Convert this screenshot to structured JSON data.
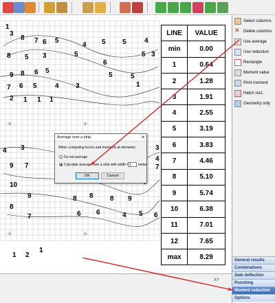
{
  "toolbar": {
    "icons": [
      "grid-icon",
      "node-icon",
      "box-icon",
      "pipe-icon",
      "funnel-icon",
      "axis-icon",
      "axis-plane-icon",
      "slab-icon",
      "wall-icon",
      "zoom-in-icon",
      "zoom-out-icon",
      "zoom-all-icon",
      "zoom-window-icon",
      "zoom-prev-icon",
      "layers-icon"
    ]
  },
  "table": {
    "headers": [
      "LINE",
      "VALUE"
    ],
    "rows": [
      {
        "line": "min",
        "value": "0.00"
      },
      {
        "line": "1",
        "value": "0.64"
      },
      {
        "line": "2",
        "value": "1.28"
      },
      {
        "line": "3",
        "value": "1.91"
      },
      {
        "line": "4",
        "value": "2.55"
      },
      {
        "line": "5",
        "value": "3.19"
      },
      {
        "line": "6",
        "value": "3.83"
      },
      {
        "line": "7",
        "value": "4.46"
      },
      {
        "line": "8",
        "value": "5.10"
      },
      {
        "line": "9",
        "value": "5.74"
      },
      {
        "line": "10",
        "value": "6.38"
      },
      {
        "line": "11",
        "value": "7.01"
      },
      {
        "line": "12",
        "value": "7.65"
      },
      {
        "line": "max",
        "value": "8.29"
      }
    ]
  },
  "panel": {
    "items": [
      {
        "label": "Select columns",
        "icon": "select-columns-icon"
      },
      {
        "label": "Delete columns",
        "icon": "delete-columns-icon"
      },
      {
        "label": "Use average",
        "icon": "use-average-icon"
      },
      {
        "label": "Use reduction",
        "icon": "use-reduction-icon"
      },
      {
        "label": "Rectangle",
        "icon": "rectangle-icon"
      },
      {
        "label": "Moment value",
        "icon": "moment-value-icon"
      },
      {
        "label": "Print moment",
        "icon": "print-moment-icon"
      },
      {
        "label": "Hatch rect.",
        "icon": "hatch-rect-icon"
      },
      {
        "label": "Geometry only",
        "icon": "geometry-only-icon"
      }
    ],
    "sections": [
      {
        "label": "General results",
        "active": false
      },
      {
        "label": "Combinations",
        "active": false
      },
      {
        "label": "Slab deflection",
        "active": false
      },
      {
        "label": "Punching",
        "active": false
      },
      {
        "label": "Moment reduction",
        "active": true
      },
      {
        "label": "Options",
        "active": false
      }
    ],
    "accent": "#3d6fb8"
  },
  "dialog": {
    "title": "Average over a strip",
    "description": "When computing forces and moments at elements:",
    "option_no_average": "Do not average",
    "option_calc_average": "Calculate average over a strip with width =",
    "width_value": "1",
    "unit": "meter",
    "ok_label": "OK",
    "cancel_label": "Cancel",
    "selected_option": "option_calc_average"
  },
  "canvas": {
    "contour_label_color": "#000000",
    "arrow_color": "#e02020",
    "side_labels": [
      "2",
      "2",
      "1"
    ],
    "bottom_labels": [
      "1",
      "2",
      "1"
    ]
  },
  "status": {
    "axis_label": "XY"
  }
}
